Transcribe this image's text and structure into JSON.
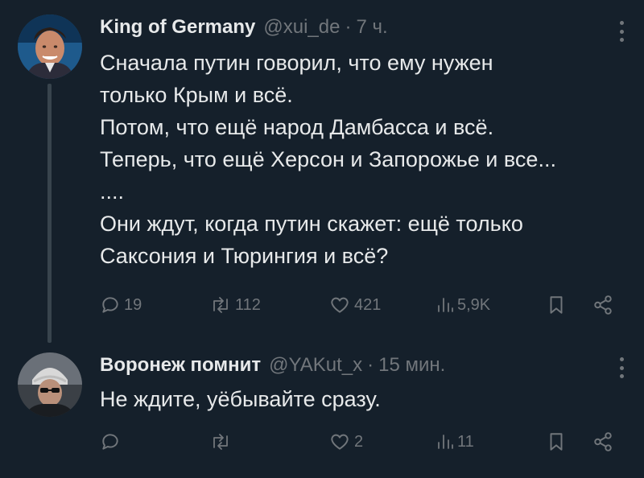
{
  "tweets": [
    {
      "author": "King of Germany",
      "handle": "@xui_de",
      "dot": "·",
      "time": "7 ч.",
      "text_lines": [
        "Сначала путин говорил, что ему нужен",
        "только Крым и всё.",
        "Потом, что ещё народ Дамбасса и всё.",
        "Теперь, что ещё Херсон и Запорожье и все...",
        "....",
        "Они ждут, когда путин скажет: ещё только",
        "Саксония и Тюрингия и всё?"
      ],
      "replies": "19",
      "retweets": "112",
      "likes": "421",
      "views": "5,9K"
    },
    {
      "author": "Воронеж помнит",
      "handle": "@YAKut_x",
      "dot": "·",
      "time": "15 мин.",
      "text_lines": [
        "Не ждите, уёбывайте сразу."
      ],
      "replies": "",
      "retweets": "",
      "likes": "2",
      "views": "11"
    }
  ],
  "colors": {
    "background": "#15202b",
    "text": "#e7e9ea",
    "muted": "#71767b",
    "thread_line": "#38444d"
  },
  "icons": [
    "reply-icon",
    "retweet-icon",
    "like-icon",
    "views-icon",
    "bookmark-icon",
    "share-icon",
    "more-icon"
  ]
}
